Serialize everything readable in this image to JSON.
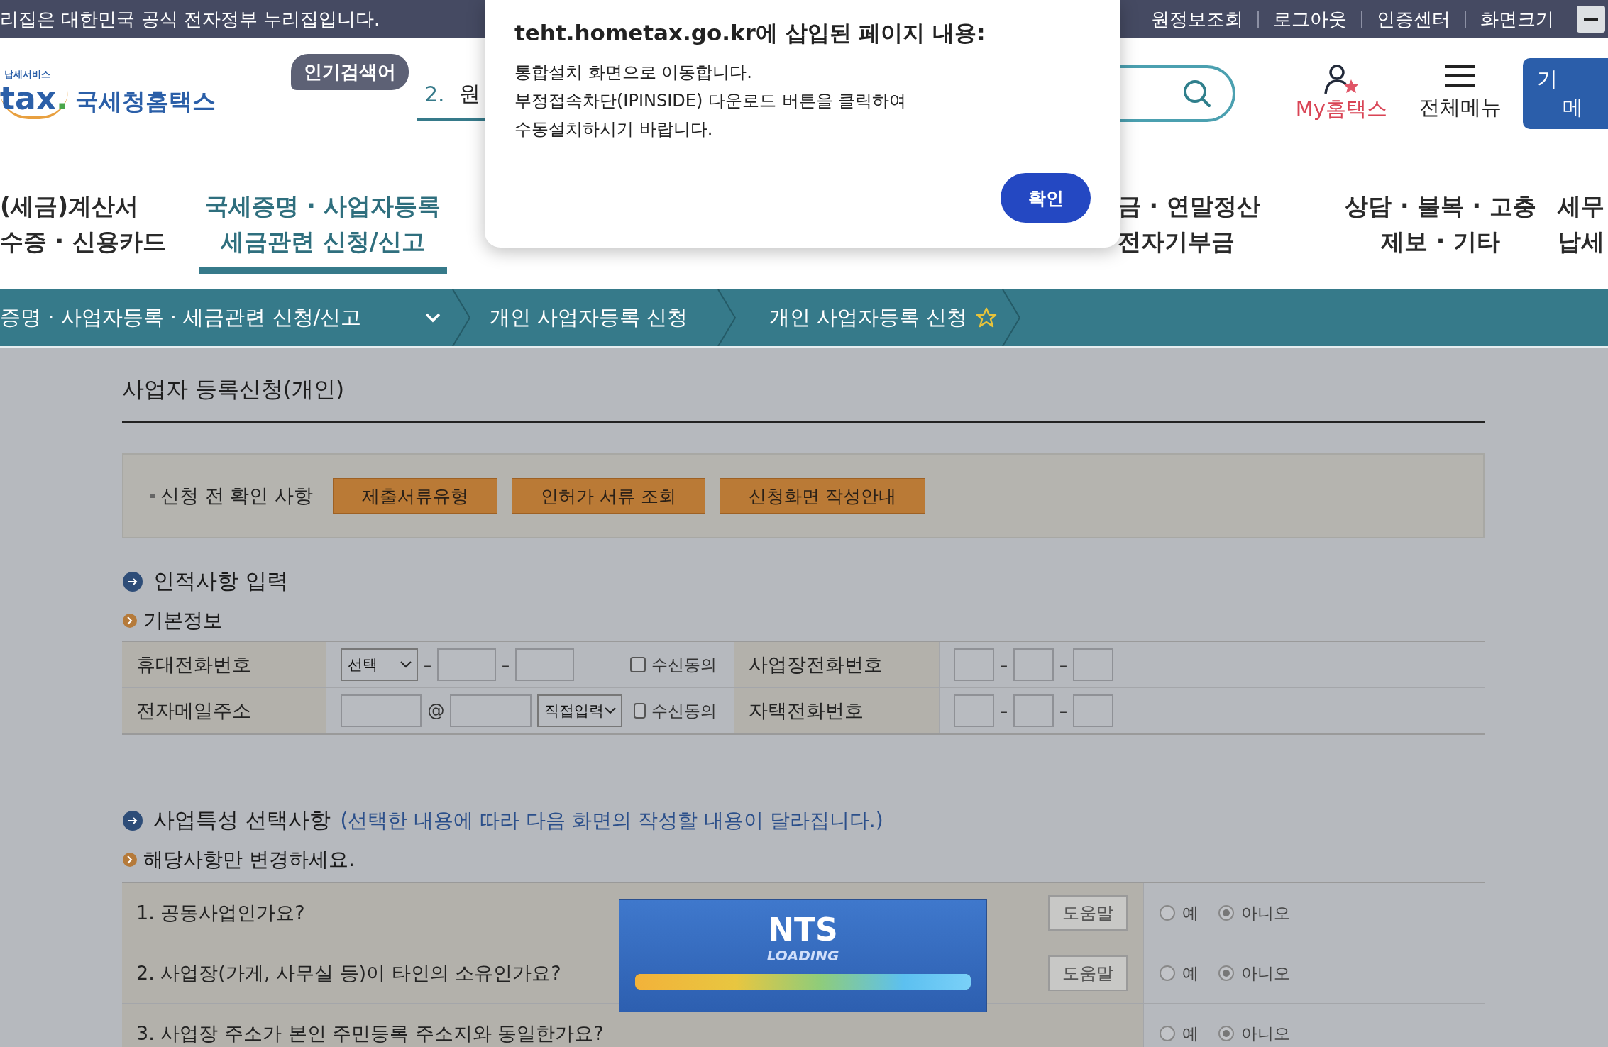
{
  "top_bar": {
    "notice": "리집은 대한민국 공식 전자정부 누리집입니다.",
    "links": [
      "원정보조회",
      "로그아웃",
      "인증센터",
      "화면크기"
    ]
  },
  "header": {
    "logo": {
      "tagline": "납세서비스",
      "mark": "tax",
      "dot": ".",
      "name": "국세청홈택스"
    },
    "popular": {
      "badge": "인기검색어",
      "rank": "2.",
      "term": "원"
    },
    "my_hometax": "My홈택스",
    "all_menu": "전체메뉴",
    "side_button": [
      "기",
      "메"
    ]
  },
  "nav": [
    {
      "lines": [
        "(세금)계산서",
        "수증 · 신용카드"
      ],
      "selected": false
    },
    {
      "lines": [
        "국세증명 · 사업자등록",
        "세금관련 신청/신고"
      ],
      "selected": true
    },
    {
      "lines": [
        "금 · 연말정산",
        "전자기부금"
      ],
      "selected": false
    },
    {
      "lines": [
        "상담 · 불복 · 고충",
        "제보 · 기타"
      ],
      "selected": false
    },
    {
      "lines": [
        "세무",
        "납세"
      ],
      "selected": false
    }
  ],
  "breadcrumb": [
    {
      "label": "증명 · 사업자등록 · 세금관련 신청/신고",
      "kind": "dropdown"
    },
    {
      "label": "개인 사업자등록 신청",
      "kind": "plain"
    },
    {
      "label": "개인 사업자등록 신청",
      "kind": "favorite",
      "favorite": false
    }
  ],
  "form": {
    "title": "사업자 등록신청(개인)",
    "precheck": {
      "label": "신청 전 확인 사항",
      "buttons": [
        "제출서류유형",
        "인허가 서류 조회",
        "신청화면 작성안내"
      ]
    },
    "personal": {
      "title": "인적사항 입력",
      "subtitle": "기본정보",
      "rows": [
        {
          "label": "휴대전화번호",
          "kind": "phone",
          "select": "선택",
          "separators": [
            "–",
            "–"
          ],
          "consent": "수신동의",
          "checked": false,
          "right_label": "사업장전화번호",
          "right_separators": [
            "–",
            "–"
          ]
        },
        {
          "label": "전자메일주소",
          "kind": "email",
          "at": "@",
          "select": "직접입력",
          "consent": "수신동의",
          "checked": false,
          "right_label": "자택전화번호",
          "right_separators": [
            "–",
            "–"
          ]
        }
      ]
    },
    "business": {
      "title": "사업특성 선택사항",
      "note": "(선택한 내용에 따라 다음 화면의 작성할 내용이 달라집니다.)",
      "subtitle": "해당사항만 변경하세요.",
      "questions": [
        {
          "text": "1. 공동사업인가요?",
          "help": "도움말",
          "options": [
            {
              "label": "예",
              "selected": false
            },
            {
              "label": "아니오",
              "selected": true
            }
          ]
        },
        {
          "text": "2. 사업장(가게, 사무실 등)이 타인의 소유인가요?",
          "help": "도움말",
          "options": [
            {
              "label": "예",
              "selected": false
            },
            {
              "label": "아니오",
              "selected": true
            }
          ]
        },
        {
          "text": "3. 사업장 주소가 본인 주민등록 주소지와 동일한가요?",
          "options": [
            {
              "label": "예",
              "selected": false
            },
            {
              "label": "아니오",
              "selected": true
            }
          ]
        }
      ]
    }
  },
  "loading": {
    "title": "NTS",
    "subtitle": "LOADING",
    "level": 1
  },
  "dialog": {
    "title": "teht.hometax.go.kr에 삽입된 페이지 내용:",
    "lines": [
      "통합설치 화면으로 이동합니다.",
      "부정접속차단(IPINSIDE) 다운로드 버튼을 클릭하여",
      "수동설치하시기 바랍니다."
    ],
    "ok": "확인"
  }
}
